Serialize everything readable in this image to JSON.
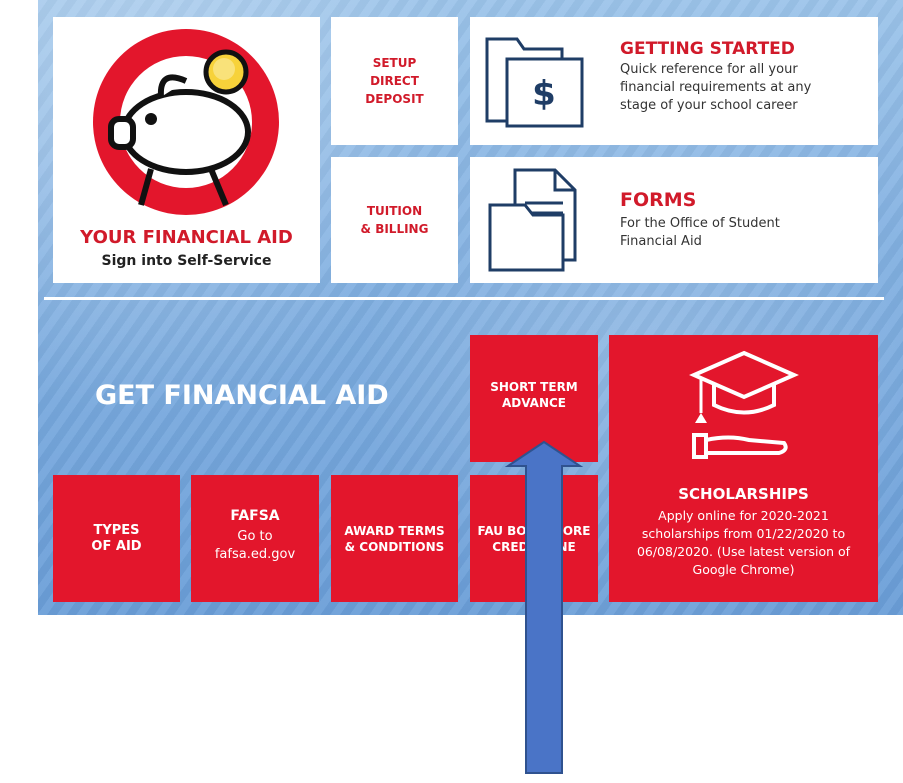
{
  "header": {
    "financial_aid_title": "YOUR FINANCIAL AID",
    "financial_aid_sub": "Sign into Self-Service",
    "setup_label": "SETUP\nDIRECT\nDEPOSIT",
    "tuition_label": "TUITION\n& BILLING",
    "getting_started_title": "GETTING STARTED",
    "getting_started_desc": "Quick reference for all your\nfinancial requirements at any\nstage of your school career",
    "forms_title": "FORMS",
    "forms_desc": "For the Office of Student\nFinancial Aid"
  },
  "section": {
    "get_aid_title": "GET FINANCIAL AID",
    "short_term_label": "SHORT TERM\nADVANCE",
    "types_label": "TYPES\nOF AID",
    "fafsa_title": "FAFSA",
    "fafsa_desc": "Go to\nfafsa.ed.gov",
    "award_terms_label": "AWARD TERMS\n& CONDITIONS",
    "bookstore_label": "FAU BOOKSTORE\nCREDIT LINE",
    "scholarships_title": "SCHOLARSHIPS",
    "scholarships_desc": "Apply online for 2020-2021\nscholarships from 01/22/2020 to\n06/08/2020. (Use latest version of\nGoogle Chrome)"
  },
  "colors": {
    "brand_red": "#e3162c",
    "arrow_blue": "#4a74c7"
  },
  "icons": [
    "piggy-bank-icon",
    "folder-dollar-icon",
    "forms-document-icon",
    "graduation-cap-hand-icon",
    "up-arrow-icon"
  ]
}
